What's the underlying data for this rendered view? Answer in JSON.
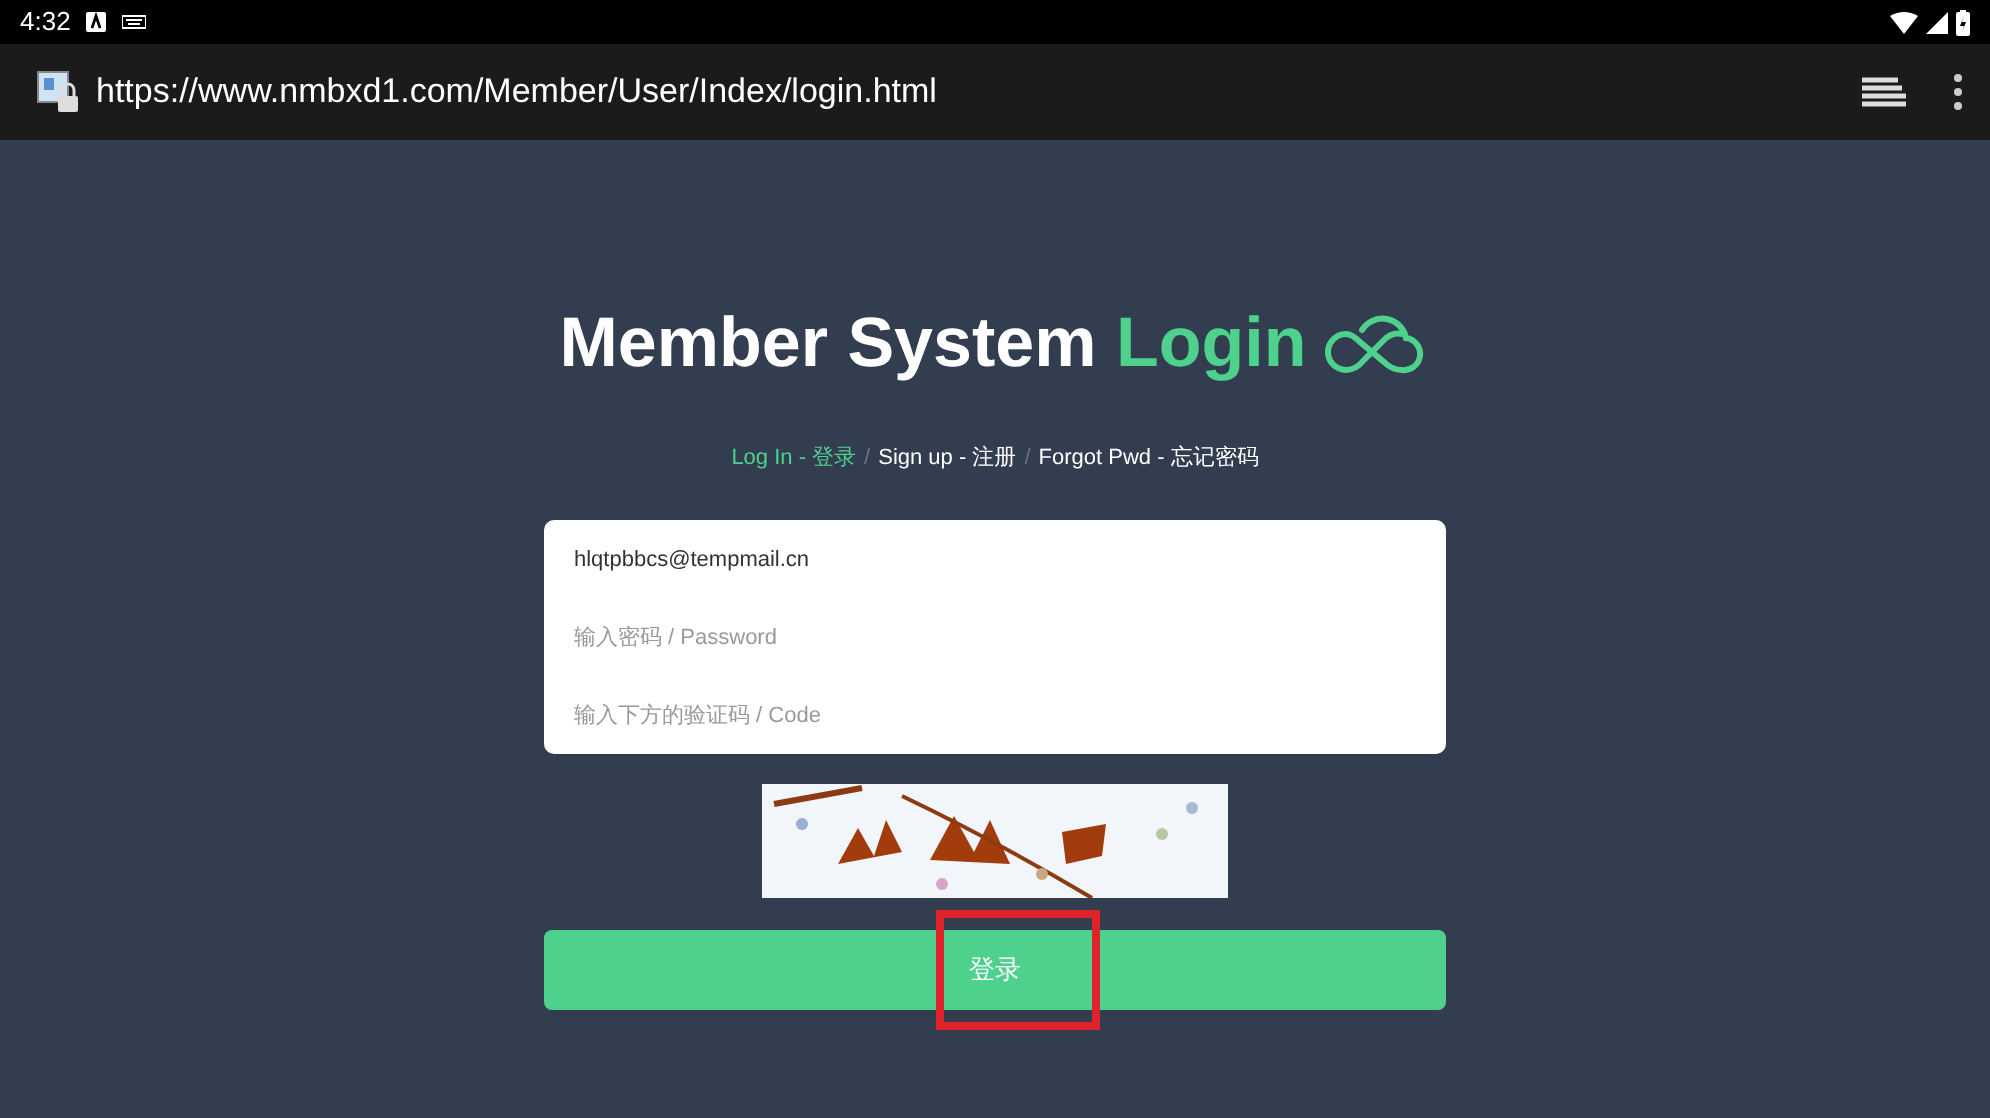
{
  "status_bar": {
    "time": "4:32"
  },
  "browser": {
    "url": "https://www.nmbxd1.com/Member/User/Index/login.html"
  },
  "heading": {
    "title": "Member System",
    "accent": "Login"
  },
  "tabs": [
    {
      "label": "Log In - 登录",
      "selected": true
    },
    {
      "label": "Sign up - 注册",
      "selected": false
    },
    {
      "label": "Forgot Pwd - 忘记密码",
      "selected": false
    }
  ],
  "tab_separators": [
    "/",
    "/"
  ],
  "fields": [
    {
      "value": "hlqtpbbcs@tempmail.cn"
    },
    {
      "placeholder": "输入密码 / Password"
    },
    {
      "placeholder": "输入下方的验证码 / Code"
    }
  ],
  "captcha": {
    "kind": "picture"
  },
  "submit": {
    "label": "登录",
    "highlighted": true
  }
}
